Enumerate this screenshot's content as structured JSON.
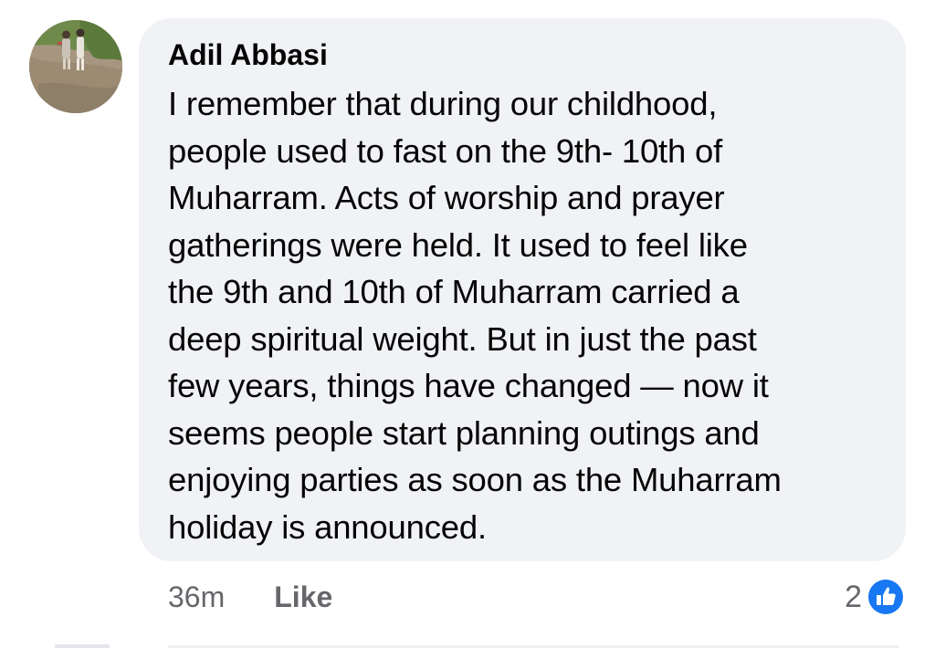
{
  "comment": {
    "author": "Adil Abbasi",
    "text_lines": [
      "I remember that during our childhood,",
      "people used to fast on the 9th- 10th of",
      "Muharram. Acts of worship and prayer",
      "gatherings were held. It used to feel like",
      "the 9th and 10th of Muharram carried a",
      "deep spiritual weight. But in just the past",
      "few years, things have changed — now it",
      "seems people start planning outings and",
      "enjoying parties as soon as the Muharram",
      "holiday is announced."
    ],
    "timestamp": "36m",
    "like_label": "Like",
    "reaction_count": "2",
    "reaction_icon": "thumbs-up-icon"
  },
  "colors": {
    "bubble_bg": "#f0f2f5",
    "text": "#050505",
    "meta_text": "#65676b",
    "like_blue": "#1877f2"
  }
}
